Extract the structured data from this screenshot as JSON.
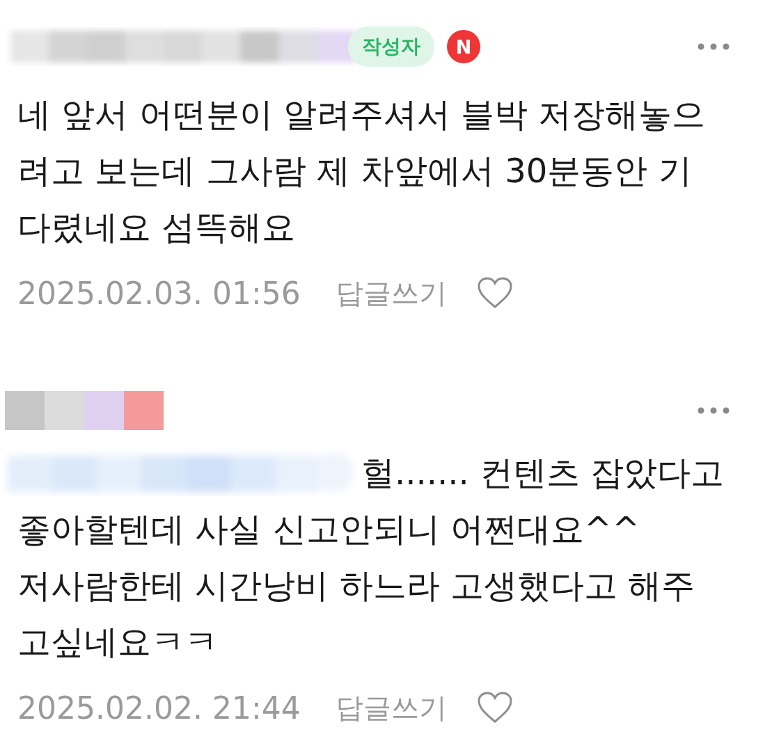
{
  "comments": [
    {
      "author_badge": "작성자",
      "badge_icon": "N",
      "lead_blur": false,
      "text_lines": [
        "네 앞서 어떤분이 알려주셔서 블박 저장해놓으",
        "려고 보는데 그사람 제 차앞에서 30분동안 기",
        "다렸네요 섬뜩해요"
      ],
      "date": "2025.02.03. 01:56",
      "reply": "답글쓰기",
      "liked": false
    },
    {
      "lead_blur": true,
      "text_lines": [
        "헐....... 컨텐츠 잡았다고",
        "좋아할텐데 사실 신고안되니 어쩐대요^^",
        "저사람한테 시간낭비 하느라 고생했다고 해주",
        "고싶네요ㅋㅋ"
      ],
      "date": "2025.02.02. 21:44",
      "reply": "답글쓰기",
      "liked": false
    }
  ]
}
